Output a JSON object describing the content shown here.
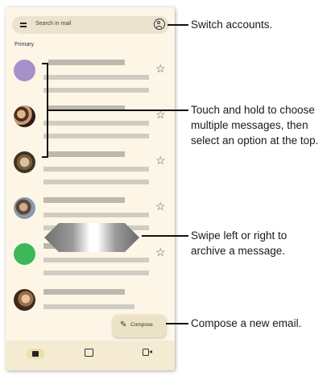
{
  "search": {
    "placeholder": "Search in mail"
  },
  "section_label": "Primary",
  "compose": {
    "label": "Compose"
  },
  "bottom_nav": [
    {
      "icon": "mail-icon",
      "active": true
    },
    {
      "icon": "chat-icon",
      "active": false
    },
    {
      "icon": "meet-icon",
      "active": false
    }
  ],
  "callouts": {
    "switch_accounts": "Switch accounts.",
    "touch_hold": [
      "Touch and hold to choose",
      "multiple messages, then",
      "select an option at the top."
    ],
    "swipe": [
      "Swipe left or right to",
      "archive a message."
    ],
    "compose": "Compose a new email."
  },
  "colors": {
    "avatar_purple": "#a890c8",
    "avatar_green": "#3cb85a",
    "background": "#fdf6e7"
  }
}
